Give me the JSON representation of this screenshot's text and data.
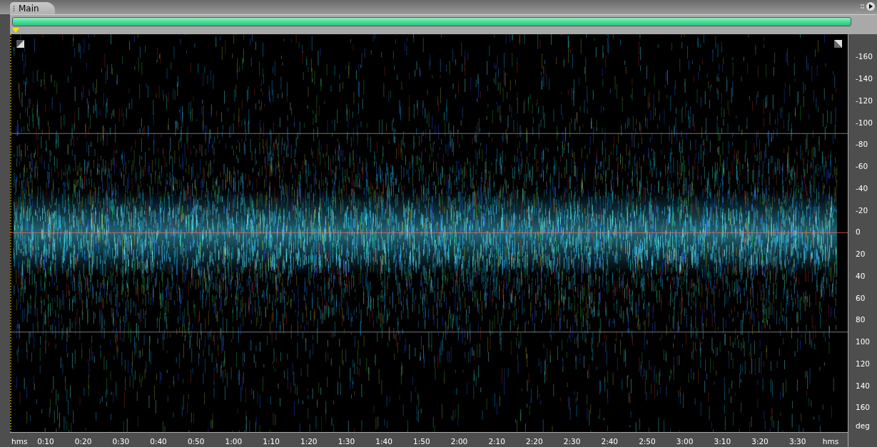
{
  "tab": {
    "label": "Main",
    "selected": true
  },
  "scrollbar": {
    "level": 1
  },
  "y_axis": {
    "labels": [
      "-160",
      "-140",
      "-120",
      "-100",
      "-80",
      "-60",
      "-40",
      "-20",
      "0",
      "20",
      "40",
      "60",
      "80",
      "100",
      "120",
      "140",
      "160"
    ],
    "unit": "deg"
  },
  "x_axis": {
    "unit_start": "hms",
    "labels": [
      "0:10",
      "0:20",
      "0:30",
      "0:40",
      "0:50",
      "1:00",
      "1:10",
      "1:20",
      "1:30",
      "1:40",
      "1:50",
      "2:00",
      "2:10",
      "2:20",
      "2:30",
      "2:40",
      "2:50",
      "3:00",
      "3:10",
      "3:20",
      "3:30"
    ],
    "unit_end": "hms"
  }
}
